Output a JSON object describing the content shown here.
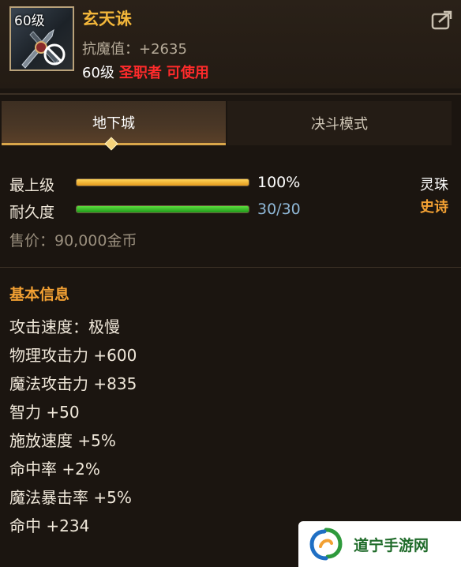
{
  "item": {
    "level_badge": "60级",
    "name": "玄天诛",
    "magic_resist": "抗魔值：+2635",
    "required_level": "60级",
    "required_class": "圣职者",
    "usable_status": "可使用"
  },
  "tabs": [
    {
      "label": "地下城",
      "active": true
    },
    {
      "label": "决斗模式",
      "active": false
    }
  ],
  "stats": {
    "upgrade": {
      "label": "最上级",
      "value_text": "100%",
      "fill": 1.0
    },
    "durability": {
      "label": "耐久度",
      "value_text": "30/30",
      "fill": 1.0
    },
    "type_label": "灵珠",
    "rarity_label": "史诗"
  },
  "price": "售价：90,000金币",
  "basic_info": {
    "title": "基本信息",
    "attributes": [
      "攻击速度：极慢",
      "物理攻击力 +600",
      "魔法攻击力 +835",
      "智力 +50",
      "施放速度 +5%",
      "命中率 +2%",
      "魔法暴击率 +5%",
      "命中 +234"
    ]
  },
  "watermark": {
    "text": "道宁手游网"
  },
  "icons": {
    "share": "share-icon",
    "ban": "ban-icon",
    "weapon": "weapon-icon",
    "logo": "logo-icon"
  },
  "colors": {
    "item_name": "#f2b63a",
    "class_req": "#ff2b2b",
    "rarity": "#f2a033",
    "durability_text": "#8fb7d6"
  }
}
